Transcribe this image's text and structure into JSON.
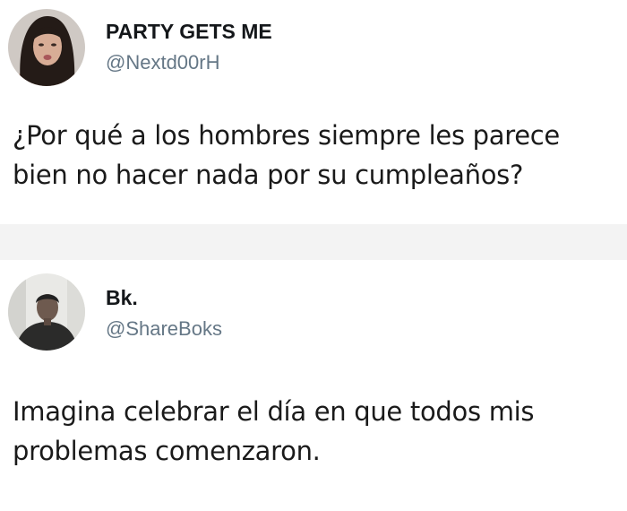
{
  "tweets": [
    {
      "display_name": "PARTY GETS ME",
      "handle": "@Nextd00rH",
      "text_lines": [
        "¿Por qué a los hombres siempre les parece",
        "bien no hacer nada por su cumpleaños?"
      ],
      "avatar_icon": "woman-portrait-avatar"
    },
    {
      "display_name": "Bk.",
      "handle": "@ShareBoks",
      "text_lines": [
        "Imagina celebrar el día en que todos mis",
        "problemas comenzaron."
      ],
      "avatar_icon": "man-portrait-avatar"
    }
  ],
  "colors": {
    "name": "#14171a",
    "handle": "#657786",
    "body_text": "#1a1a1a",
    "separator": "#f3f3f3"
  }
}
